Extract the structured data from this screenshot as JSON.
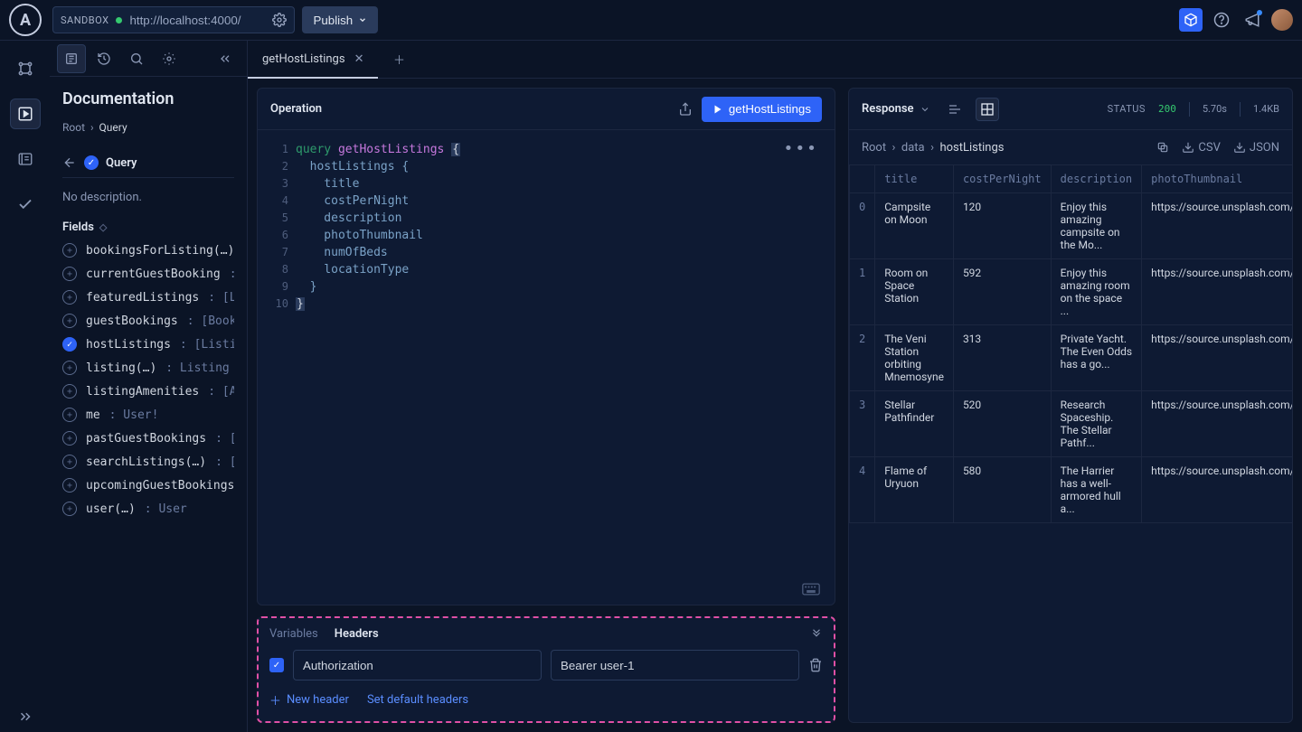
{
  "topbar": {
    "sandbox_label": "SANDBOX",
    "url": "http://localhost:4000/",
    "publish": "Publish"
  },
  "docs": {
    "title": "Documentation",
    "breadcrumb_root": "Root",
    "breadcrumb_leaf": "Query",
    "query_label": "Query",
    "no_desc": "No description.",
    "fields_label": "Fields",
    "fields": [
      {
        "name": "bookingsForListing(…)",
        "type": ":",
        "selected": false
      },
      {
        "name": "currentGuestBooking",
        "type": ": B…",
        "selected": false
      },
      {
        "name": "featuredListings",
        "type": ": [Lis…",
        "selected": false
      },
      {
        "name": "guestBookings",
        "type": ": [Bookin…",
        "selected": false
      },
      {
        "name": "hostListings",
        "type": ": [Listing…",
        "selected": true
      },
      {
        "name": "listing(…)",
        "type": ": Listing",
        "selected": false
      },
      {
        "name": "listingAmenities",
        "type": ": [Ame…",
        "selected": false
      },
      {
        "name": "me",
        "type": ": User!",
        "selected": false
      },
      {
        "name": "pastGuestBookings",
        "type": ": [Bo…",
        "selected": false
      },
      {
        "name": "searchListings(…)",
        "type": ": [Li…",
        "selected": false
      },
      {
        "name": "upcomingGuestBookings",
        "type": ":",
        "selected": false
      },
      {
        "name": "user(…)",
        "type": ": User",
        "selected": false
      }
    ]
  },
  "tab": {
    "name": "getHostListings"
  },
  "operation": {
    "title": "Operation",
    "run_label": "getHostListings",
    "code": {
      "kw": "query",
      "name": "getHostListings",
      "lines": [
        "hostListings {",
        "  title",
        "  costPerNight",
        "  description",
        "  photoThumbnail",
        "  numOfBeds",
        "  locationType",
        "}"
      ]
    }
  },
  "varhead": {
    "tab_vars": "Variables",
    "tab_headers": "Headers",
    "hdr_key": "Authorization",
    "hdr_val": "Bearer user-1",
    "new_header": "New header",
    "set_default": "Set default headers"
  },
  "response": {
    "title": "Response",
    "status_label": "STATUS",
    "status_code": "200",
    "time": "5.70s",
    "size": "1.4KB",
    "path": [
      "Root",
      "data",
      "hostListings"
    ],
    "csv": "CSV",
    "json": "JSON",
    "columns": [
      "title",
      "costPerNight",
      "description",
      "photoThumbnail"
    ],
    "rows": [
      {
        "title": "Campsite on Moon",
        "cost": "120",
        "desc": "Enjoy this amazing campsite on the Mo...",
        "photo": "https://source.unsplash.com/fe"
      },
      {
        "title": "Room on Space Station",
        "cost": "592",
        "desc": "Enjoy this amazing room on the space ...",
        "photo": "https://source.unsplash.com/fe"
      },
      {
        "title": "The Veni Station orbiting Mnemosyne",
        "cost": "313",
        "desc": "Private Yacht. The Even Odds has a go...",
        "photo": "https://source.unsplash.com/fe"
      },
      {
        "title": "Stellar Pathfinder",
        "cost": "520",
        "desc": "Research Spaceship. The Stellar Pathf...",
        "photo": "https://source.unsplash.com/fe"
      },
      {
        "title": "Flame of Uryuon",
        "cost": "580",
        "desc": "The Harrier has a well-armored hull a...",
        "photo": "https://source.unsplash.com/fe"
      }
    ]
  }
}
